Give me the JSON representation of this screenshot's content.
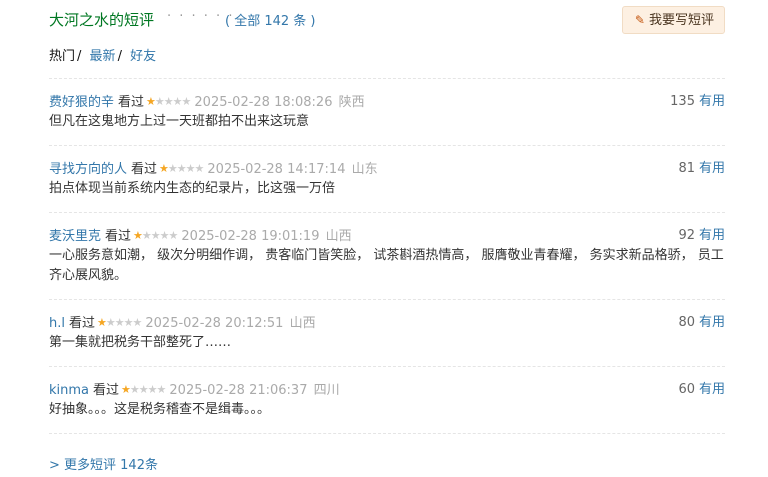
{
  "header": {
    "title": "大河之水的短评",
    "dots": "· · · · · ·",
    "total": "( 全部 142 条 )",
    "write_button": "我要写短评"
  },
  "filters": {
    "hot": "热门",
    "latest": "最新",
    "friends": "好友"
  },
  "comments": [
    {
      "user": "费好狠的辛",
      "watched": "看过",
      "rating": 1,
      "time": "2025-02-28 18:08:26",
      "location": "陕西",
      "votes": "135",
      "useful": "有用",
      "content": "但凡在这鬼地方上过一天班都拍不出来这玩意"
    },
    {
      "user": "寻找方向的人",
      "watched": "看过",
      "rating": 1,
      "time": "2025-02-28 14:17:14",
      "location": "山东",
      "votes": "81",
      "useful": "有用",
      "content": "拍点体现当前系统内生态的纪录片，比这强一万倍"
    },
    {
      "user": "麦沃里克",
      "watched": "看过",
      "rating": 1,
      "time": "2025-02-28 19:01:19",
      "location": "山西",
      "votes": "92",
      "useful": "有用",
      "content": "一心服务意如潮， 级次分明细作调， 贵客临门皆笑脸， 试茶斟酒热情高， 服膺敬业青春耀， 务实求新品格骄， 员工齐心展风貌。"
    },
    {
      "user": "h.l",
      "watched": "看过",
      "rating": 1,
      "time": "2025-02-28 20:12:51",
      "location": "山西",
      "votes": "80",
      "useful": "有用",
      "content": "第一集就把税务干部整死了……"
    },
    {
      "user": "kinma",
      "watched": "看过",
      "rating": 1,
      "time": "2025-02-28 21:06:37",
      "location": "四川",
      "votes": "60",
      "useful": "有用",
      "content": "好抽象。。。这是税务稽查不是缉毒。。。"
    }
  ],
  "more_link": "> 更多短评 142条",
  "colors": {
    "accent_link": "#3377aa",
    "title_green": "#007722",
    "star": "#f5a623"
  }
}
